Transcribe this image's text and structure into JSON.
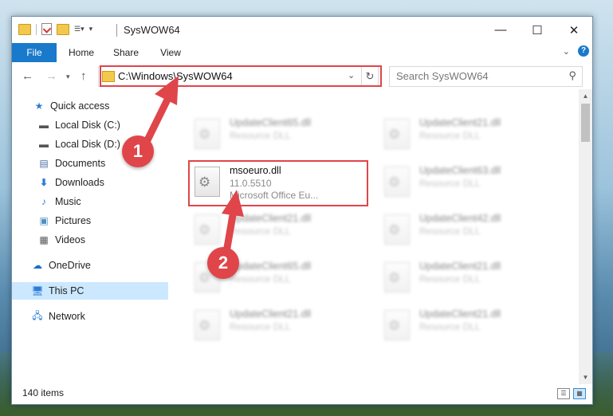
{
  "window": {
    "title": "SysWOW64"
  },
  "ribbon": {
    "tabs": [
      "File",
      "Home",
      "Share",
      "View"
    ]
  },
  "address": {
    "path": "C:\\Windows\\SysWOW64"
  },
  "search": {
    "placeholder": "Search SysWOW64"
  },
  "sidebar": {
    "items": [
      {
        "label": "Quick access",
        "icon": "star-icon",
        "pinned": false
      },
      {
        "label": "Local Disk (C:)",
        "icon": "drive-icon",
        "pinned": true
      },
      {
        "label": "Local Disk (D:)",
        "icon": "drive-icon",
        "pinned": true
      },
      {
        "label": "Documents",
        "icon": "documents-icon",
        "pinned": true
      },
      {
        "label": "Downloads",
        "icon": "download-icon",
        "pinned": true
      },
      {
        "label": "Music",
        "icon": "music-icon",
        "pinned": true
      },
      {
        "label": "Pictures",
        "icon": "pictures-icon",
        "pinned": true
      },
      {
        "label": "Videos",
        "icon": "videos-icon",
        "pinned": true
      },
      {
        "label": "OneDrive",
        "icon": "cloud-icon",
        "pinned": false
      },
      {
        "label": "This PC",
        "icon": "computer-icon",
        "pinned": false,
        "selected": true
      },
      {
        "label": "Network",
        "icon": "network-icon",
        "pinned": false
      }
    ]
  },
  "files": [
    {
      "name": "UpdateClient65.dll",
      "type": "Resource DLL",
      "blurred": true
    },
    {
      "name": "UpdateClient21.dll",
      "type": "Resource DLL",
      "blurred": true
    },
    {
      "name": "msoeuro.dll",
      "version": "11.0.5510",
      "type": "Microsoft Office Eu...",
      "blurred": false
    },
    {
      "name": "UpdateClient63.dll",
      "type": "Resource DLL",
      "blurred": true
    },
    {
      "name": "UpdateClient21.dll",
      "type": "Resource DLL",
      "blurred": true
    },
    {
      "name": "UpdateClient42.dll",
      "type": "Resource DLL",
      "blurred": true
    },
    {
      "name": "UpdateClient65.dll",
      "type": "Resource DLL",
      "blurred": true
    },
    {
      "name": "UpdateClient21.dll",
      "type": "Resource DLL",
      "blurred": true
    },
    {
      "name": "UpdateClient21.dll",
      "type": "Resource DLL",
      "blurred": true
    },
    {
      "name": "UpdateClient21.dll",
      "type": "Resource DLL",
      "blurred": true
    }
  ],
  "status": {
    "item_count": "140 items"
  },
  "annotations": {
    "step1": "1",
    "step2": "2",
    "color": "#e0454a"
  }
}
